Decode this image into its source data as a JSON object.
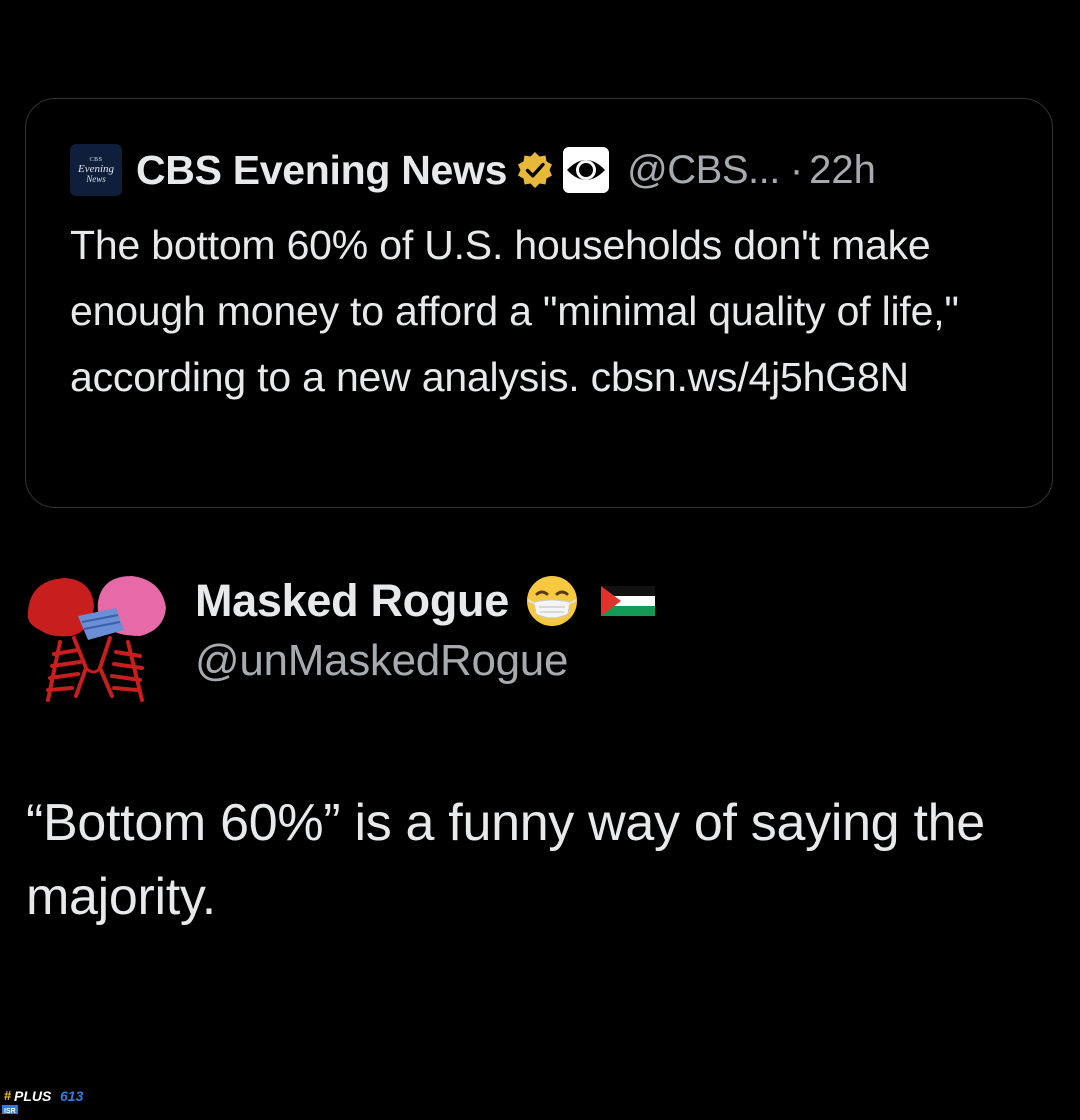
{
  "quoted_tweet": {
    "avatar_text": {
      "line1": "CBS",
      "line2": "Evening",
      "line3": "News"
    },
    "display_name": "CBS Evening News",
    "handle": "@CBS...",
    "separator": "·",
    "time": "22h",
    "text": "The bottom 60% of U.S. households don't make enough money to afford a \"minimal quality of life,\" according to a new analysis. cbsn.ws/4j5hG8N",
    "badges": [
      "verified-gold-badge-icon",
      "cbs-eye-logo-icon"
    ]
  },
  "reply_tweet": {
    "display_name": "Masked Rogue",
    "handle": "@unMaskedRogue",
    "name_emojis": [
      "face-with-medical-mask-icon",
      "palestine-flag-icon"
    ],
    "avatar": "skeletons-kissing-avatar",
    "text": "“Bottom 60%” is a funny way of saying the majority."
  },
  "watermark": {
    "text": "#PLUS613",
    "sub": "ISR"
  },
  "colors": {
    "background": "#000000",
    "primary_text": "#e7e9ea",
    "secondary_text": "#a6abb0",
    "card_border": "#2f3336",
    "verified_gold": "#e8b83a"
  }
}
